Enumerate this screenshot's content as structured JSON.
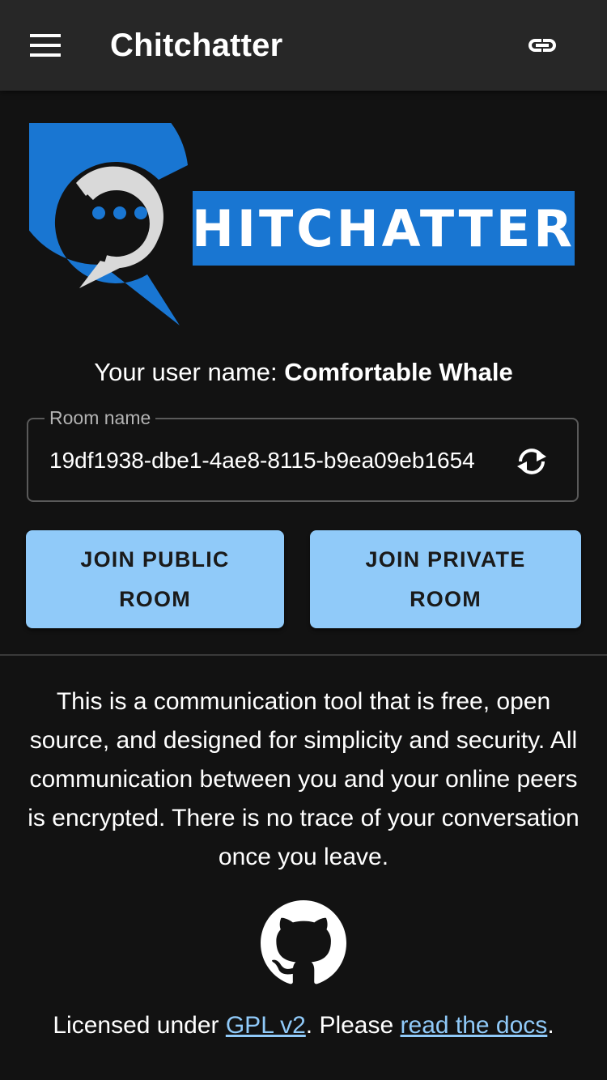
{
  "appbar": {
    "title": "Chitchatter",
    "menu_icon": "hamburger-menu-icon",
    "link_icon": "link-icon"
  },
  "logo": {
    "wordmark": "HITCHATTER",
    "colors": {
      "blue": "#1976d2",
      "grey": "#d9d9d9"
    }
  },
  "user": {
    "prefix": "Your user name: ",
    "name": "Comfortable Whale"
  },
  "room": {
    "label": "Room name",
    "value": "19df1938-dbe1-4ae8-8115-b9ea09eb1654",
    "regenerate_icon": "sync-icon"
  },
  "buttons": {
    "join_public": "JOIN PUBLIC ROOM",
    "join_private": "JOIN PRIVATE ROOM"
  },
  "description": "This is a communication tool that is free, open source, and designed for simplicity and security. All communication between you and your online peers is encrypted. There is no trace of your conversation once you leave.",
  "footer": {
    "github_icon": "github-icon",
    "licensed_prefix": "Licensed under ",
    "license_link": "GPL v2",
    "middle": ". Please ",
    "docs_link": "read the docs",
    "suffix": "."
  },
  "colors": {
    "background": "#121212",
    "appbar": "#272727",
    "primary_light": "#90caf9",
    "brand_blue": "#1976d2"
  }
}
